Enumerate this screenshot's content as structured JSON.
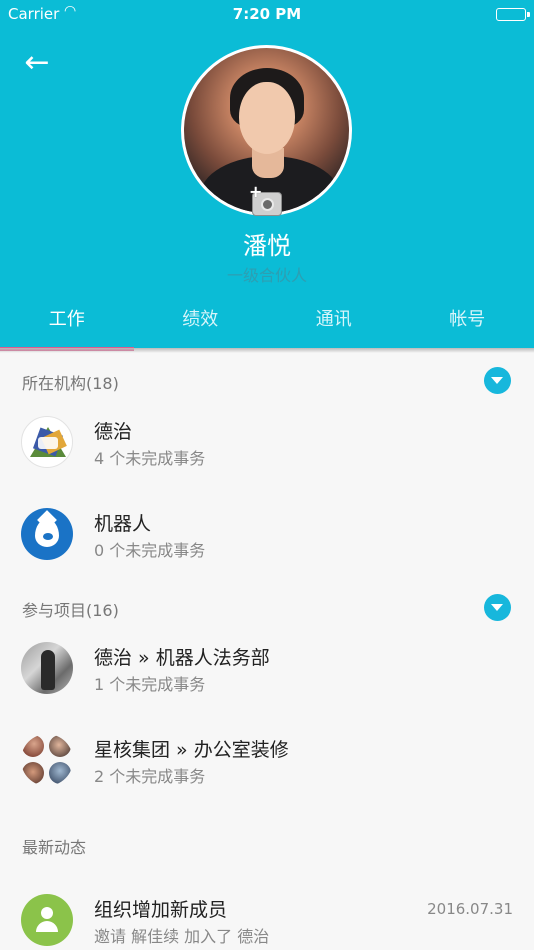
{
  "status_bar": {
    "carrier": "Carrier",
    "time": "7:20 PM"
  },
  "profile": {
    "name": "潘悦",
    "role": "一级合伙人"
  },
  "tabs": [
    {
      "label": "工作",
      "active": true
    },
    {
      "label": "绩效",
      "active": false
    },
    {
      "label": "通讯",
      "active": false
    },
    {
      "label": "帐号",
      "active": false
    }
  ],
  "colors": {
    "header": "#0bbcd6",
    "tab_indicator": "#e05c8e",
    "toggle": "#17b7dc"
  },
  "organizations": {
    "label": "所在机构(18)",
    "items": [
      {
        "title": "德治",
        "subtitle": "4 个未完成事务",
        "icon": "dezhi-logo"
      },
      {
        "title": "机器人",
        "subtitle": "0 个未完成事务",
        "icon": "drupal-logo"
      }
    ]
  },
  "projects": {
    "label": "参与项目(16)",
    "items": [
      {
        "title": "德治 » 机器人法务部",
        "subtitle": "1 个未完成事务",
        "icon": "project-photo"
      },
      {
        "title": "星核集团 » 办公室装修",
        "subtitle": "2 个未完成事务",
        "icon": "member-avatars-grid"
      }
    ]
  },
  "activity": {
    "label": "最新动态",
    "items": [
      {
        "title": "组织增加新成员",
        "subtitle": "邀请 解佳续 加入了 德治",
        "date": "2016.07.31",
        "icon": "user-icon"
      }
    ]
  }
}
